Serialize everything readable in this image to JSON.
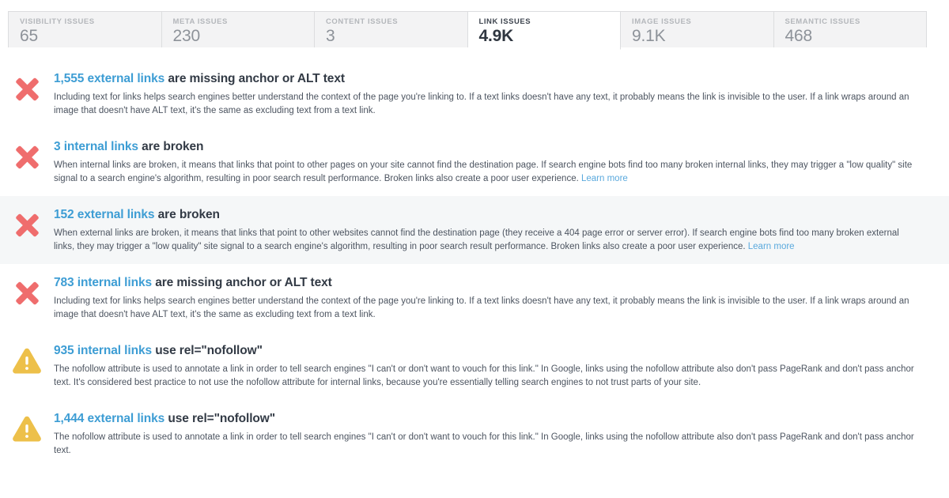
{
  "tabs": [
    {
      "label": "VISIBILITY ISSUES",
      "value": "65",
      "active": false,
      "name": "tab-visibility-issues"
    },
    {
      "label": "META ISSUES",
      "value": "230",
      "active": false,
      "name": "tab-meta-issues"
    },
    {
      "label": "CONTENT ISSUES",
      "value": "3",
      "active": false,
      "name": "tab-content-issues"
    },
    {
      "label": "LINK ISSUES",
      "value": "4.9K",
      "active": true,
      "name": "tab-link-issues"
    },
    {
      "label": "IMAGE ISSUES",
      "value": "9.1K",
      "active": false,
      "name": "tab-image-issues"
    },
    {
      "label": "SEMANTIC ISSUES",
      "value": "468",
      "active": false,
      "name": "tab-semantic-issues"
    }
  ],
  "colors": {
    "error_icon": "#ef6d6d",
    "warning_icon": "#edc04a",
    "count_link": "#3d9dd4",
    "learn_more_link": "#5aa9dd",
    "tab_active_text": "#2f3640",
    "tab_inactive_text": "#8d9299",
    "row_highlight_bg": "#f5f7f8"
  },
  "issues": [
    {
      "icon": "error-x-icon",
      "severity": "error",
      "highlighted": false,
      "count": "1,555 external links",
      "title_rest": " are missing anchor or ALT text",
      "description": "Including text for links helps search engines better understand the context of the page you're linking to. If a text links doesn't have any text, it probably means the link is invisible to the user. If a link wraps around an image that doesn't have ALT text, it's the same as excluding text from a text link.",
      "learn_more": ""
    },
    {
      "icon": "error-x-icon",
      "severity": "error",
      "highlighted": false,
      "count": "3 internal links",
      "title_rest": " are broken",
      "description": "When internal links are broken, it means that links that point to other pages on your site cannot find the destination page. If search engine bots find too many broken internal links, they may trigger a \"low quality\" site signal to a search engine's algorithm, resulting in poor search result performance. Broken links also create a poor user experience. ",
      "learn_more": "Learn more"
    },
    {
      "icon": "error-x-icon",
      "severity": "error",
      "highlighted": true,
      "count": "152 external links",
      "title_rest": " are broken",
      "description": "When external links are broken, it means that links that point to other websites cannot find the destination page (they receive a 404 page error or server error). If search engine bots find too many broken external links, they may trigger a \"low quality\" site signal to a search engine's algorithm, resulting in poor search result performance. Broken links also create a poor user experience. ",
      "learn_more": "Learn more"
    },
    {
      "icon": "error-x-icon",
      "severity": "error",
      "highlighted": false,
      "count": "783 internal links",
      "title_rest": " are missing anchor or ALT text",
      "description": "Including text for links helps search engines better understand the context of the page you're linking to. If a text links doesn't have any text, it probably means the link is invisible to the user. If a link wraps around an image that doesn't have ALT text, it's the same as excluding text from a text link.",
      "learn_more": ""
    },
    {
      "icon": "warning-triangle-icon",
      "severity": "warning",
      "highlighted": false,
      "count": "935 internal links",
      "title_rest": " use rel=\"nofollow\"",
      "description": "The nofollow attribute is used to annotate a link in order to tell search engines \"I can't or don't want to vouch for this link.\" In Google, links using the nofollow attribute also don't pass PageRank and don't pass anchor text. It's considered best practice to not use the nofollow attribute for internal links, because you're essentially telling search engines to not trust parts of your site.",
      "learn_more": ""
    },
    {
      "icon": "warning-triangle-icon",
      "severity": "warning",
      "highlighted": false,
      "count": "1,444 external links",
      "title_rest": " use rel=\"nofollow\"",
      "description": "The nofollow attribute is used to annotate a link in order to tell search engines \"I can't or don't want to vouch for this link.\" In Google, links using the nofollow attribute also don't pass PageRank and don't pass anchor text.",
      "learn_more": ""
    }
  ]
}
